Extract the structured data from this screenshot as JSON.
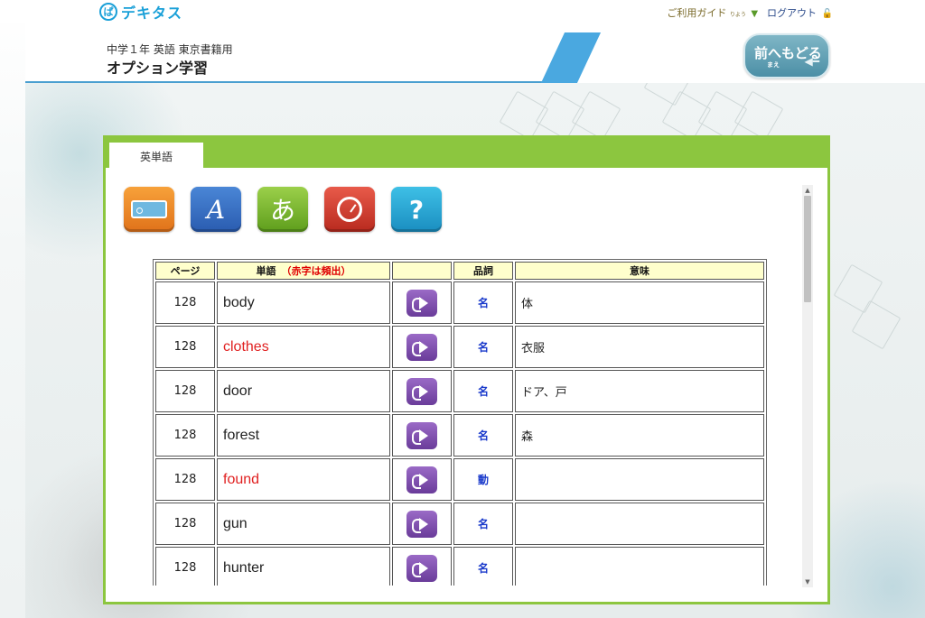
{
  "brand": {
    "name": "デキタス",
    "logo_glyph": "ぱ"
  },
  "toplinks": {
    "guide_label": "ご利用ガイド",
    "guide_ruby": "りよう",
    "logout_label": "ログアウト"
  },
  "header": {
    "subtitle": "中学１年 英語 東京書籍用",
    "title": "オプション学習",
    "back_label": "前へもどる",
    "back_ruby": "まえ"
  },
  "tab": {
    "label": "英単語"
  },
  "tools": [
    {
      "icon": "tag-icon"
    },
    {
      "icon": "alphabet-icon",
      "glyph": "A"
    },
    {
      "icon": "hiragana-icon",
      "glyph": "あ"
    },
    {
      "icon": "timer-icon"
    },
    {
      "icon": "help-icon",
      "glyph": "?"
    }
  ],
  "table": {
    "headers": {
      "page": "ページ",
      "word": "単語",
      "word_note": "（赤字は頻出）",
      "sound": "",
      "pos": "品詞",
      "meaning": "意味"
    },
    "rows": [
      {
        "page": "128",
        "word": "body",
        "frequent": false,
        "pos": "名",
        "meaning": "体"
      },
      {
        "page": "128",
        "word": "clothes",
        "frequent": true,
        "pos": "名",
        "meaning": "衣服"
      },
      {
        "page": "128",
        "word": "door",
        "frequent": false,
        "pos": "名",
        "meaning": "ドア、戸"
      },
      {
        "page": "128",
        "word": "forest",
        "frequent": false,
        "pos": "名",
        "meaning": "森"
      },
      {
        "page": "128",
        "word": "found",
        "frequent": true,
        "pos": "動",
        "meaning": ""
      },
      {
        "page": "128",
        "word": "gun",
        "frequent": false,
        "pos": "名",
        "meaning": ""
      },
      {
        "page": "128",
        "word": "hunter",
        "frequent": false,
        "pos": "名",
        "meaning": ""
      }
    ]
  },
  "colors": {
    "accent_green": "#8cc63f",
    "frequent_red": "#e02020",
    "pos_blue": "#1a3acb",
    "header_yellow": "#ffffcc"
  }
}
